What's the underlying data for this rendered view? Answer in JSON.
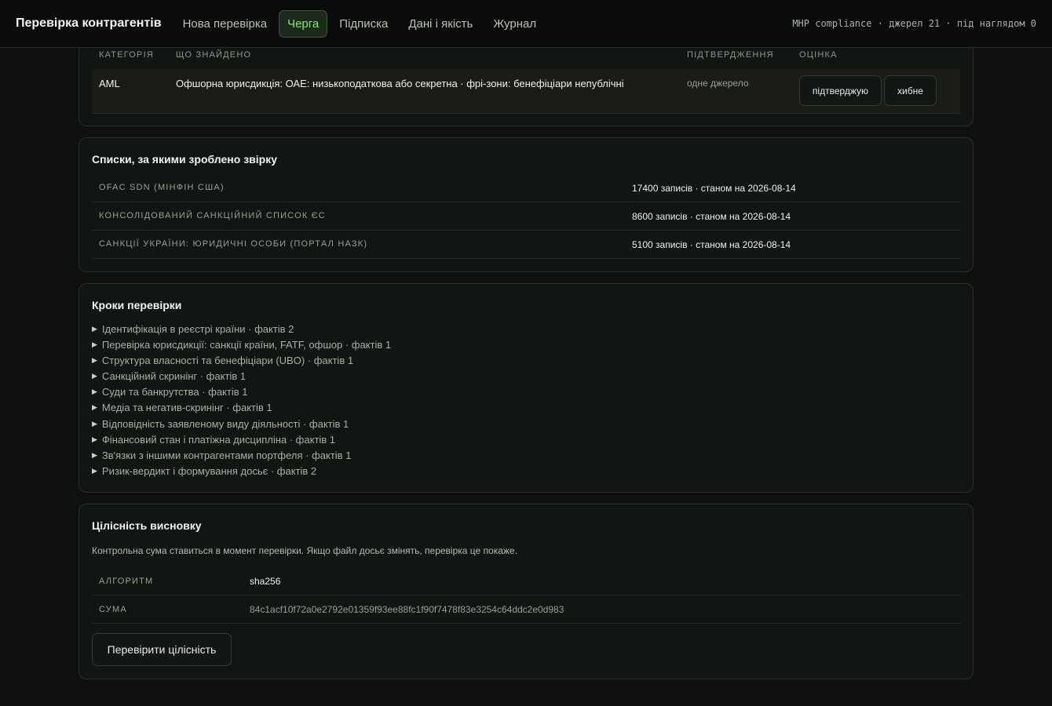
{
  "topbar": {
    "brand": "Перевірка контрагентів",
    "nav": [
      "Нова перевірка",
      "Черга",
      "Підписка",
      "Дані і якість",
      "Журнал"
    ],
    "active_nav": "Черга",
    "status": "МНР compliance · джерел 21 · під наглядом 0"
  },
  "findings": {
    "headers": {
      "category": "КАТЕГОРІЯ",
      "found": "ЩО ЗНАЙДЕНО",
      "confirmation": "ПІДТВЕРДЖЕННЯ",
      "rating": "ОЦІНКА"
    },
    "rows": [
      {
        "category": "AML",
        "found": "Офшорна юрисдикція: ОАЕ: низькоподаткова або секретна · фрі-зони: бенефіціари непублічні",
        "confirmation": "одне джерело",
        "confirm_button": "підтверджую",
        "false_button": "хибне"
      }
    ]
  },
  "lists": {
    "title": "Списки, за якими зроблено звірку",
    "rows": [
      {
        "name": "OFAC SDN (Мінфін США)",
        "value": "17400 записів · станом на 2026-08-14"
      },
      {
        "name": "Консолідований санкційний список ЄС",
        "value": "8600 записів · станом на 2026-08-14"
      },
      {
        "name": "Санкції України: юридичні особи (портал НАЗК)",
        "value": "5100 записів · станом на 2026-08-14"
      }
    ]
  },
  "steps": {
    "title": "Кроки перевірки",
    "items": [
      "Ідентифікація в реєстрі країни · фактів 2",
      "Перевірка юрисдикції: санкції країни, FATF, офшор · фактів 1",
      "Структура власності та бенефіціари (UBO) · фактів 1",
      "Санкційний скринінг · фактів 1",
      "Суди та банкрутства · фактів 1",
      "Медіа та негатив-скринінг · фактів 1",
      "Відповідність заявленому виду діяльності · фактів 1",
      "Фінансовий стан і платіжна дисципліна · фактів 1",
      "Зв'язки з іншими контрагентами портфеля · фактів 1",
      "Ризик-вердикт і формування досьє · фактів 2"
    ]
  },
  "integrity": {
    "title": "Цілісність висновку",
    "description": "Контрольна сума ставиться в момент перевірки. Якщо файл досьє змінять, перевірка це покаже.",
    "algorithm_label": "АЛГОРИТМ",
    "algorithm_value": "sha256",
    "sum_label": "СУМА",
    "sum_value": "84c1acf10f72a0e2792e01359f93ee88fc1f90f7478f83e3254c64ddc2e0d983",
    "verify_button": "Перевірити цілісність"
  },
  "colors": {
    "background": "#0e110f",
    "card": "#121613",
    "accent_green": "#8fe07a",
    "active_nav_bg": "#1c2a1b"
  }
}
